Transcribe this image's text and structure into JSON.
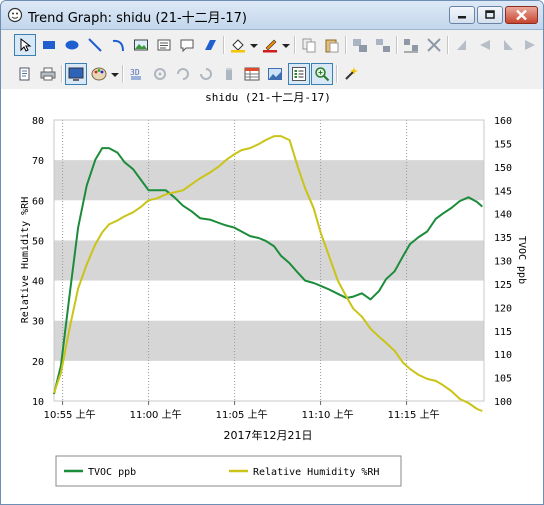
{
  "window": {
    "title": "Trend Graph: shidu (21-十二月-17)"
  },
  "toolbar": {
    "row1": [
      "select-arrow",
      "rectangle",
      "ellipse",
      "line",
      "arc",
      "image",
      "panel",
      "callout",
      "polygon",
      "fill-color",
      "line-color",
      "copy",
      "paste",
      "group",
      "ungroup",
      "align",
      "distribute",
      "flip-left",
      "rotate-left",
      "flip-right",
      "rotate-right"
    ],
    "row2": [
      "print-preview",
      "print",
      "display-mode",
      "palette",
      "3d",
      "pan",
      "rotate",
      "spin",
      "bar",
      "table",
      "image-edit",
      "legend-toggle",
      "zoom",
      "settings"
    ]
  },
  "chart_data": {
    "type": "line",
    "title": "shidu (21-十二月-17)",
    "xlabel": "2017年12月21日",
    "x_ticks": [
      "10:55 上午",
      "11:00 上午",
      "11:05 上午",
      "11:10 上午",
      "11:15 上午"
    ],
    "y_left": {
      "label": "Relative Humidity %RH",
      "min": 10,
      "max": 80,
      "ticks": [
        10,
        20,
        30,
        40,
        50,
        60,
        70,
        80
      ]
    },
    "y_right": {
      "label": "TVOC ppb",
      "min": 100,
      "max": 160,
      "ticks": [
        100,
        105,
        110,
        115,
        120,
        125,
        130,
        135,
        140,
        145,
        150,
        155,
        160
      ]
    },
    "x_range_min": [
      -0.5,
      24.5
    ],
    "legend_position": "bottom",
    "series": [
      {
        "name": "TVOC ppb",
        "axis": "right",
        "color": "#1b8c3a",
        "x": [
          -0.5,
          -0.1,
          0.4,
          0.9,
          1.4,
          1.9,
          2.3,
          2.7,
          3.2,
          3.6,
          4.1,
          4.6,
          5.0,
          5.5,
          6.0,
          6.5,
          7.0,
          7.5,
          8.0,
          8.6,
          9.1,
          9.5,
          10.0,
          10.4,
          10.9,
          11.4,
          11.8,
          12.3,
          12.7,
          13.2,
          13.7,
          14.1,
          14.6,
          15.0,
          15.5,
          16.0,
          16.5,
          16.9,
          17.4,
          17.9,
          18.4,
          18.8,
          19.3,
          19.8,
          20.2,
          20.7,
          21.2,
          21.7,
          22.1,
          22.6,
          23.1,
          23.6,
          24.1,
          24.4
        ],
        "y": [
          101.5,
          107.5,
          122.5,
          137,
          146,
          151.5,
          154,
          154,
          153,
          151,
          149.5,
          147,
          145,
          145,
          145,
          143.5,
          141.7,
          140.5,
          139,
          138.7,
          138,
          137.5,
          137,
          136.2,
          135.2,
          134.8,
          134.2,
          133,
          131,
          129.4,
          127.3,
          125.7,
          125.2,
          124.6,
          123.8,
          122.9,
          122,
          122.3,
          123,
          121.7,
          123.5,
          126,
          127.7,
          131,
          133.5,
          135,
          136.2,
          138.9,
          140,
          141.2,
          142.7,
          143.5,
          142.5,
          141.5
        ]
      },
      {
        "name": "Relative Humidity %RH",
        "axis": "left",
        "color": "#c9c417",
        "x": [
          -0.5,
          -0.1,
          0.4,
          0.9,
          1.4,
          1.9,
          2.3,
          2.7,
          3.2,
          3.6,
          4.1,
          4.6,
          5.0,
          5.5,
          6.0,
          6.5,
          7.0,
          7.5,
          8.0,
          8.6,
          9.1,
          9.5,
          10.0,
          10.4,
          10.9,
          11.4,
          11.8,
          12.3,
          12.7,
          13.2,
          13.7,
          14.1,
          14.6,
          15.0,
          15.5,
          16.0,
          16.5,
          16.9,
          17.4,
          17.9,
          18.4,
          18.8,
          19.3,
          19.8,
          20.2,
          20.7,
          21.2,
          21.7,
          22.1,
          22.6,
          23.1,
          23.6,
          24.1,
          24.4
        ],
        "y": [
          12,
          17,
          28,
          38,
          44,
          49,
          52,
          54,
          55,
          56,
          57,
          58.5,
          60,
          60.5,
          61.5,
          62,
          62.5,
          64,
          65.5,
          67,
          68.5,
          70,
          71.5,
          72.5,
          73,
          74,
          75,
          76,
          76,
          75,
          68,
          63,
          58,
          52,
          46,
          40,
          36,
          33,
          31,
          28,
          26,
          24.5,
          22.5,
          19.5,
          18,
          16.5,
          15.5,
          15,
          14,
          12.5,
          10.5,
          9.5,
          8,
          7.5
        ]
      }
    ]
  }
}
